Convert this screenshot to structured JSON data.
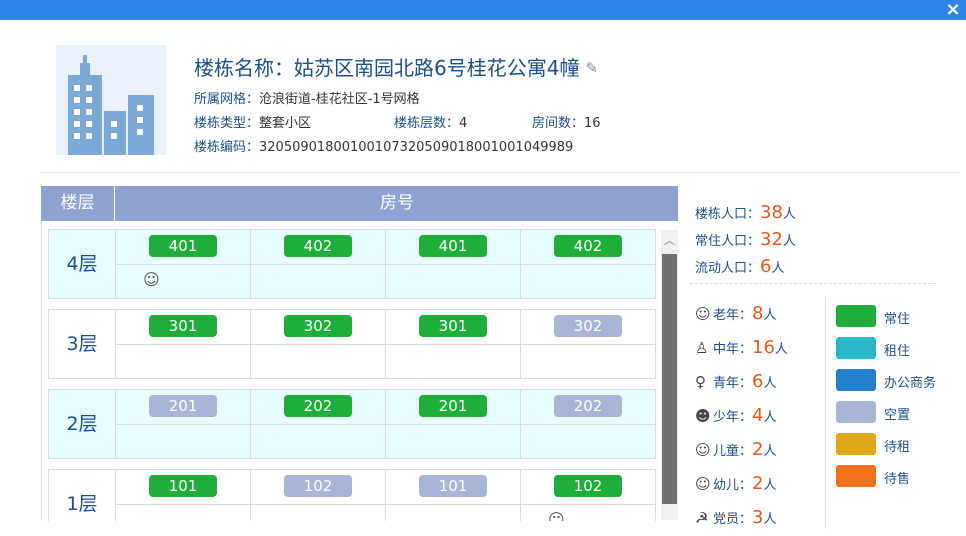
{
  "close_icon": "×",
  "building": {
    "title_label": "楼栋名称：",
    "title_value": "姑苏区南园北路6号桂花公寓4幢",
    "edit_icon": "✎",
    "grid_label": "所属网格：",
    "grid_value": "沧浪街道-桂花社区-1号网格",
    "type_label": "楼栋类型：",
    "type_value": "整套小区",
    "floors_label": "楼栋层数：",
    "floors_value": "4",
    "rooms_label": "房间数：",
    "rooms_value": "16",
    "code_label": "楼栋编码：",
    "code_value": "320509018001001073205090180010010 49989"
  },
  "table": {
    "head_floor": "楼层",
    "head_room": "房号",
    "floors": [
      {
        "label": "4层",
        "rooms": [
          {
            "no": "401",
            "status": "green",
            "icon": "elder"
          },
          {
            "no": "402",
            "status": "green"
          },
          {
            "no": "401",
            "status": "green"
          },
          {
            "no": "402",
            "status": "green"
          }
        ]
      },
      {
        "label": "3层",
        "rooms": [
          {
            "no": "301",
            "status": "green"
          },
          {
            "no": "302",
            "status": "green"
          },
          {
            "no": "301",
            "status": "green"
          },
          {
            "no": "302",
            "status": "grey"
          }
        ]
      },
      {
        "label": "2层",
        "rooms": [
          {
            "no": "201",
            "status": "grey"
          },
          {
            "no": "202",
            "status": "green"
          },
          {
            "no": "201",
            "status": "green"
          },
          {
            "no": "202",
            "status": "grey"
          }
        ]
      },
      {
        "label": "1层",
        "rooms": [
          {
            "no": "101",
            "status": "green"
          },
          {
            "no": "102",
            "status": "grey"
          },
          {
            "no": "101",
            "status": "grey"
          },
          {
            "no": "102",
            "status": "green",
            "icon": "elder"
          }
        ]
      }
    ]
  },
  "stats": {
    "total_label": "楼栋人口：",
    "total_value": "38",
    "unit": "人",
    "resident_label": "常住人口：",
    "resident_value": "32",
    "floating_label": "流动人口：",
    "floating_value": "6"
  },
  "ages": [
    {
      "icon": "☺",
      "label": "老年：",
      "value": "8",
      "unit": "人"
    },
    {
      "icon": "♙",
      "label": "中年：",
      "value": "16",
      "unit": "人"
    },
    {
      "icon": "♀",
      "label": "青年：",
      "value": "6",
      "unit": "人"
    },
    {
      "icon": "☻",
      "label": "少年：",
      "value": "4",
      "unit": "人"
    },
    {
      "icon": "☺",
      "label": "儿童：",
      "value": "2",
      "unit": "人"
    },
    {
      "icon": "☺",
      "label": "幼儿：",
      "value": "2",
      "unit": "人"
    },
    {
      "icon": "☭",
      "label": "党员：",
      "value": "3",
      "unit": "人"
    }
  ],
  "legend": [
    {
      "label": "常住",
      "color": "#1fae3b"
    },
    {
      "label": "租住",
      "color": "#29b6c7"
    },
    {
      "label": "办公商务",
      "color": "#2280cc"
    },
    {
      "label": "空置",
      "color": "#a9b5d6"
    },
    {
      "label": "待租",
      "color": "#e0a91a"
    },
    {
      "label": "待售",
      "color": "#f07218"
    }
  ]
}
